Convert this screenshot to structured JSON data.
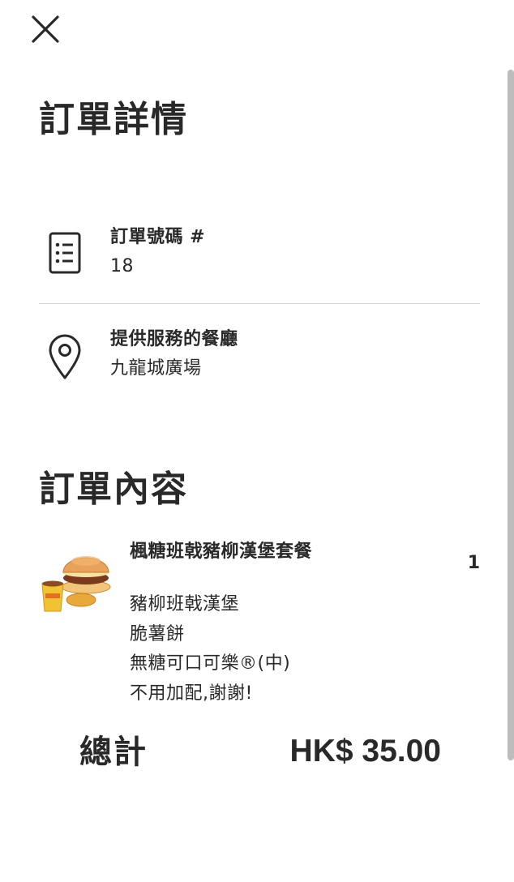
{
  "header": {
    "close_icon": "close-icon"
  },
  "order_details": {
    "title": "訂單詳情",
    "order_number": {
      "icon": "receipt-list-icon",
      "label": "訂單號碼 #",
      "value": "18"
    },
    "restaurant": {
      "icon": "location-pin-icon",
      "label": "提供服務的餐廳",
      "value": "九龍城廣場"
    }
  },
  "order_contents": {
    "title": "訂單內容",
    "items": [
      {
        "name": "楓糖班戟豬柳漢堡套餐",
        "quantity": "1",
        "options": [
          "豬柳班戟漢堡",
          "脆薯餅",
          "無糖可口可樂®(中)",
          "不用加配,謝謝!"
        ]
      }
    ]
  },
  "total": {
    "label": "總計",
    "value": "HK$ 35.00"
  },
  "colors": {
    "text": "#292929",
    "divider": "#d6d6d6",
    "background": "#ffffff"
  }
}
